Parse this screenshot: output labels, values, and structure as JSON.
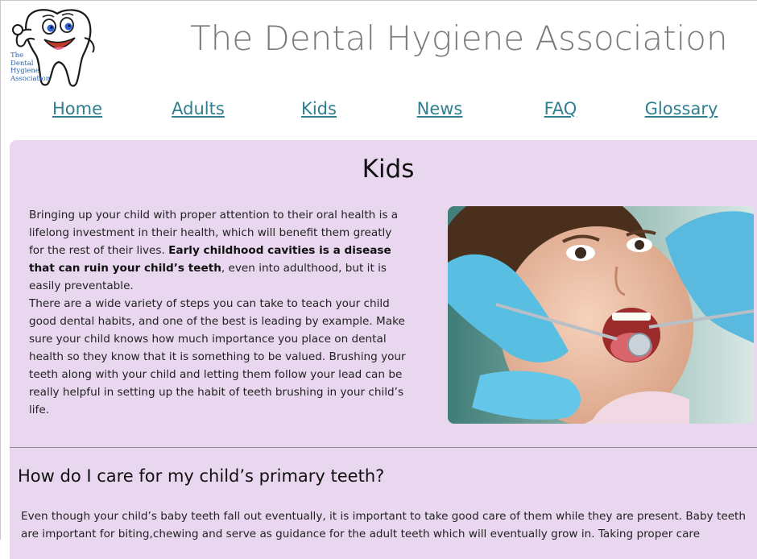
{
  "logo": {
    "text_lines": [
      "The",
      "Dental",
      "Hygiene",
      "Association"
    ],
    "icon": "smiling-tooth-icon"
  },
  "header": {
    "title": "The Dental Hygiene Association"
  },
  "nav": {
    "items": [
      {
        "label": "Home"
      },
      {
        "label": "Adults"
      },
      {
        "label": "Kids"
      },
      {
        "label": "News"
      },
      {
        "label": "FAQ"
      },
      {
        "label": "Glossary"
      }
    ],
    "link_color": "#2f7f8e"
  },
  "main": {
    "title": "Kids",
    "intro": {
      "part1": "Bringing up your child with proper attention to their oral health is a lifelong investment in their health, which will benefit them greatly for the rest of their lives. ",
      "bold": "Early childhood cavities is a disease that can ruin your child’s teeth",
      "part2": ", even into adulthood, but it is easily preventable.",
      "para2": "There are a wide variety of steps you can take to teach your child good dental habits, and one of the best is leading by example. Make sure your child knows how much importance you place on dental health so they know that it is something to be valued. Brushing your teeth along with your child and letting them follow your lead can be really helpful in setting up the habit of teeth brushing in your child’s life."
    },
    "photo": "child-dental-exam-photo",
    "section_heading": "How do I care for my child’s primary teeth?",
    "section_text": "Even though your child’s baby teeth fall out eventually, it is important to take good care of them while they are present. Baby teeth are important for biting,chewing and serve as guidance for the adult teeth which will eventually grow in. Taking proper care",
    "background": "#e8d7ef"
  }
}
